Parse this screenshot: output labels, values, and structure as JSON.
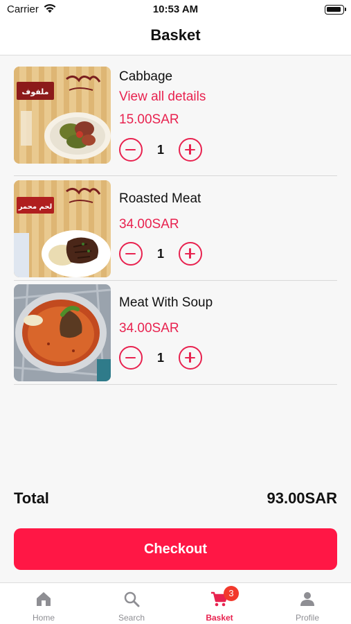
{
  "status_bar": {
    "carrier": "Carrier",
    "time": "10:53 AM"
  },
  "header": {
    "title": "Basket"
  },
  "items": [
    {
      "name": "Cabbage",
      "details_link": "View all details",
      "price": "15.00SAR",
      "quantity": "1",
      "image": "cabbage-rolls-photo",
      "image_text": "ملفوف"
    },
    {
      "name": "Roasted Meat",
      "price": "34.00SAR",
      "quantity": "1",
      "image": "roasted-meat-photo",
      "image_text": "لحم محمر"
    },
    {
      "name": "Meat With Soup",
      "price": "34.00SAR",
      "quantity": "1",
      "image": "meat-soup-photo"
    }
  ],
  "summary": {
    "total_label": "Total",
    "total_value": "93.00SAR"
  },
  "checkout": {
    "label": "Checkout"
  },
  "tabs": [
    {
      "label": "Home",
      "icon": "home-icon"
    },
    {
      "label": "Search",
      "icon": "search-icon"
    },
    {
      "label": "Basket",
      "icon": "cart-icon",
      "badge": "3",
      "active": true
    },
    {
      "label": "Profile",
      "icon": "person-icon"
    }
  ],
  "colors": {
    "accent": "#e8224f",
    "checkout": "#ff1745",
    "badge": "#f2392c"
  }
}
